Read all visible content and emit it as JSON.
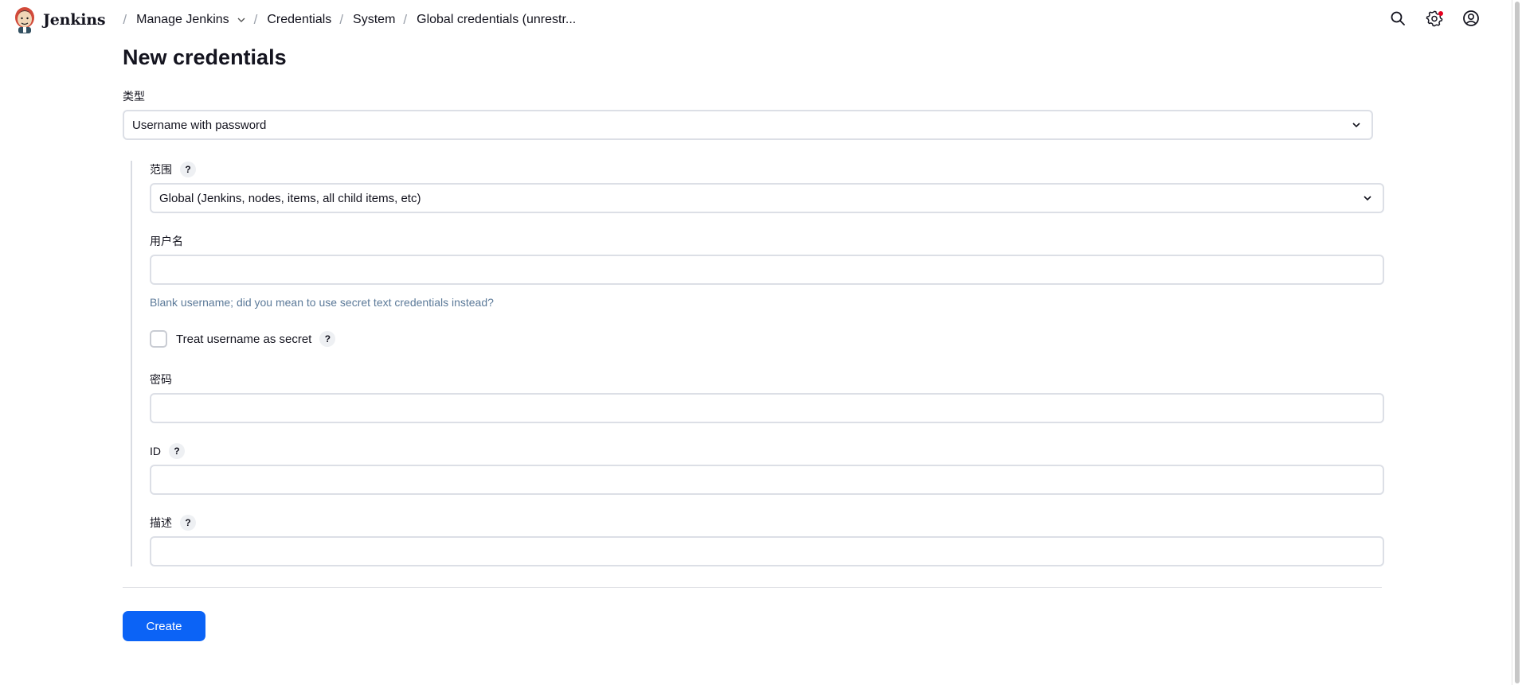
{
  "header": {
    "brand": "Jenkins",
    "breadcrumbs": [
      {
        "label": "Manage Jenkins"
      },
      {
        "label": "Credentials"
      },
      {
        "label": "System"
      },
      {
        "label": "Global credentials (unrestr..."
      }
    ],
    "separator": "/",
    "icons": [
      "search-icon",
      "gear-icon",
      "user-account-icon"
    ]
  },
  "page": {
    "title": "New credentials"
  },
  "form": {
    "kind": {
      "label": "类型",
      "value": "Username with password"
    },
    "scope": {
      "label": "范围",
      "help": "?",
      "value": "Global (Jenkins, nodes, items, all child items, etc)"
    },
    "username": {
      "label": "用户名",
      "value": "",
      "hint": "Blank username; did you mean to use secret text credentials instead?"
    },
    "treat_secret": {
      "label": "Treat username as secret",
      "help": "?",
      "checked": false
    },
    "password": {
      "label": "密码",
      "value": ""
    },
    "id": {
      "label": "ID",
      "help": "?",
      "value": ""
    },
    "description": {
      "label": "描述",
      "help": "?",
      "value": ""
    },
    "submit_label": "Create"
  },
  "colors": {
    "primary": "#0b63f6",
    "hint": "#5c7a99",
    "notification": "#e6001f"
  }
}
